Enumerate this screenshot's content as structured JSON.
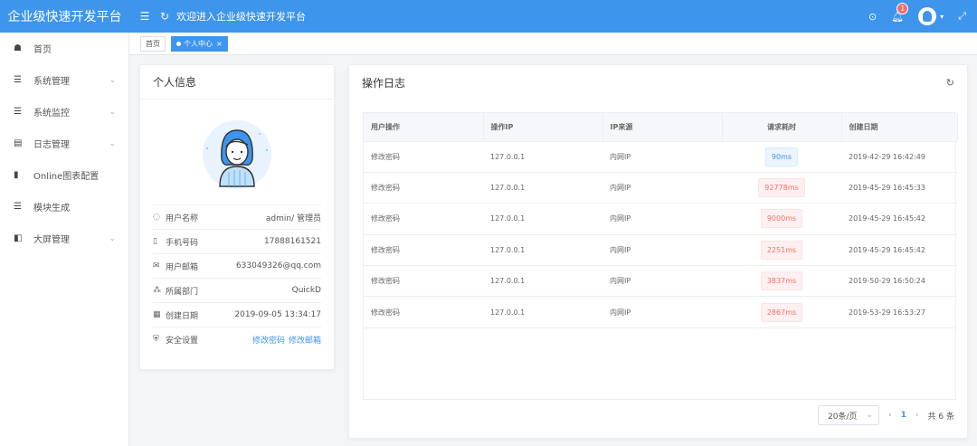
{
  "header": {
    "app_title": "企业级快速开发平台",
    "welcome": "欢迎进入企业级快速开发平台",
    "notification_count": "1"
  },
  "sidebar": {
    "items": [
      {
        "label": "首页",
        "icon": "dashboard-icon",
        "has_children": false
      },
      {
        "label": "系统管理",
        "icon": "list-icon",
        "has_children": true
      },
      {
        "label": "系统监控",
        "icon": "list-icon",
        "has_children": true
      },
      {
        "label": "日志管理",
        "icon": "file-icon",
        "has_children": true
      },
      {
        "label": "Online图表配置",
        "icon": "bar-chart-icon",
        "has_children": false
      },
      {
        "label": "模块生成",
        "icon": "list-icon",
        "has_children": false
      },
      {
        "label": "大屏管理",
        "icon": "screen-icon",
        "has_children": true
      }
    ]
  },
  "tags": {
    "home": "首页",
    "current": "个人中心"
  },
  "profile": {
    "title": "个人信息",
    "rows": [
      {
        "label": "用户名称",
        "value": "admin/ 管理员",
        "icon": "user-icon"
      },
      {
        "label": "手机号码",
        "value": "17888161521",
        "icon": "phone-icon"
      },
      {
        "label": "用户邮箱",
        "value": "633049326@qq.com",
        "icon": "mail-icon"
      },
      {
        "label": "所属部门",
        "value": "QuickD",
        "icon": "org-icon"
      },
      {
        "label": "创建日期",
        "value": "2019-09-05 13:34:17",
        "icon": "calendar-icon"
      }
    ],
    "security": {
      "label": "安全设置",
      "change_password": "修改密码",
      "change_email": "修改邮箱"
    }
  },
  "log": {
    "title": "操作日志",
    "columns": [
      "用户操作",
      "操作IP",
      "IP来源",
      "请求耗时",
      "创建日期"
    ],
    "rows": [
      {
        "action": "修改密码",
        "ip": "127.0.0.1",
        "source": "内网IP",
        "time": "90ms",
        "status": "ok",
        "date": "2019-42-29 16:42:49"
      },
      {
        "action": "修改密码",
        "ip": "127.0.0.1",
        "source": "内网IP",
        "time": "92778ms",
        "status": "bad",
        "date": "2019-45-29 16:45:33"
      },
      {
        "action": "修改密码",
        "ip": "127.0.0.1",
        "source": "内网IP",
        "time": "9000ms",
        "status": "bad",
        "date": "2019-45-29 16:45:42"
      },
      {
        "action": "修改密码",
        "ip": "127.0.0.1",
        "source": "内网IP",
        "time": "2251ms",
        "status": "bad",
        "date": "2019-45-29 16:45:42"
      },
      {
        "action": "修改密码",
        "ip": "127.0.0.1",
        "source": "内网IP",
        "time": "3837ms",
        "status": "bad",
        "date": "2019-50-29 16:50:24"
      },
      {
        "action": "修改密码",
        "ip": "127.0.0.1",
        "source": "内网IP",
        "time": "2867ms",
        "status": "bad",
        "date": "2019-53-29 16:53:27"
      }
    ],
    "pagination": {
      "page_size": "20条/页",
      "current_page": "1",
      "total": "共 6 条"
    }
  },
  "colors": {
    "primary": "#3d95ec",
    "danger": "#f56c6c"
  }
}
